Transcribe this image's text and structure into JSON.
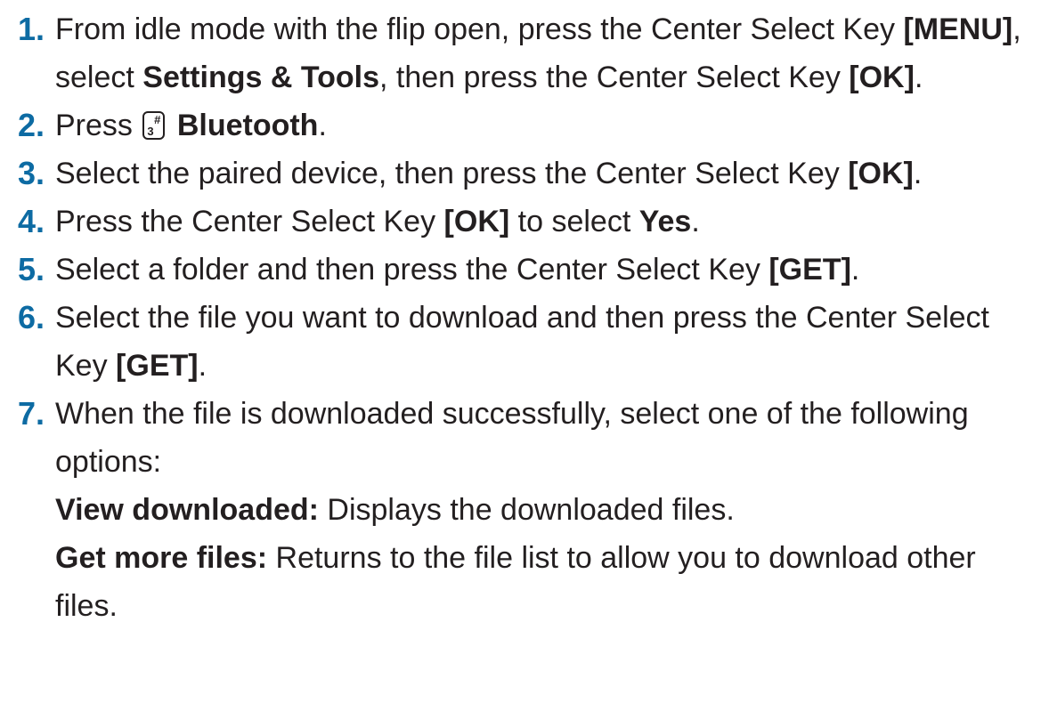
{
  "steps": [
    {
      "number": "1.",
      "t1": "From idle mode with the flip open, press the Center Select Key ",
      "b1": "[MENU]",
      "t2": ", select ",
      "b2": "Settings & Tools",
      "t3": ", then press the Center Select Key ",
      "b3": "[OK]",
      "t4": "."
    },
    {
      "number": "2.",
      "t1": "Press ",
      "key_main": "3",
      "key_sup": "#",
      "b1": "Bluetooth",
      "t2": "."
    },
    {
      "number": "3.",
      "t1": "Select the paired device, then press the Center Select Key ",
      "b1": "[OK]",
      "t2": "."
    },
    {
      "number": "4.",
      "t1": "Press the Center Select Key ",
      "b1": "[OK]",
      "t2": " to select ",
      "b2": "Yes",
      "t3": "."
    },
    {
      "number": "5.",
      "t1": "Select a folder and then press the Center Select Key ",
      "b1": "[GET]",
      "t2": "."
    },
    {
      "number": "6.",
      "t1": "Select the file you want to download and then press the Center Select Key ",
      "b1": "[GET]",
      "t2": "."
    },
    {
      "number": "7.",
      "t1": "When the file is downloaded successfully, select one of the following options:",
      "options": [
        {
          "label": "View downloaded:",
          "text": " Displays the downloaded files."
        },
        {
          "label": "Get more files:",
          "text": " Returns to the file list to allow you to download other files."
        }
      ]
    }
  ],
  "colors": {
    "step_number": "#0d6ba3",
    "text": "#231f20"
  },
  "icons": {
    "key": "key-3-hash-icon"
  }
}
